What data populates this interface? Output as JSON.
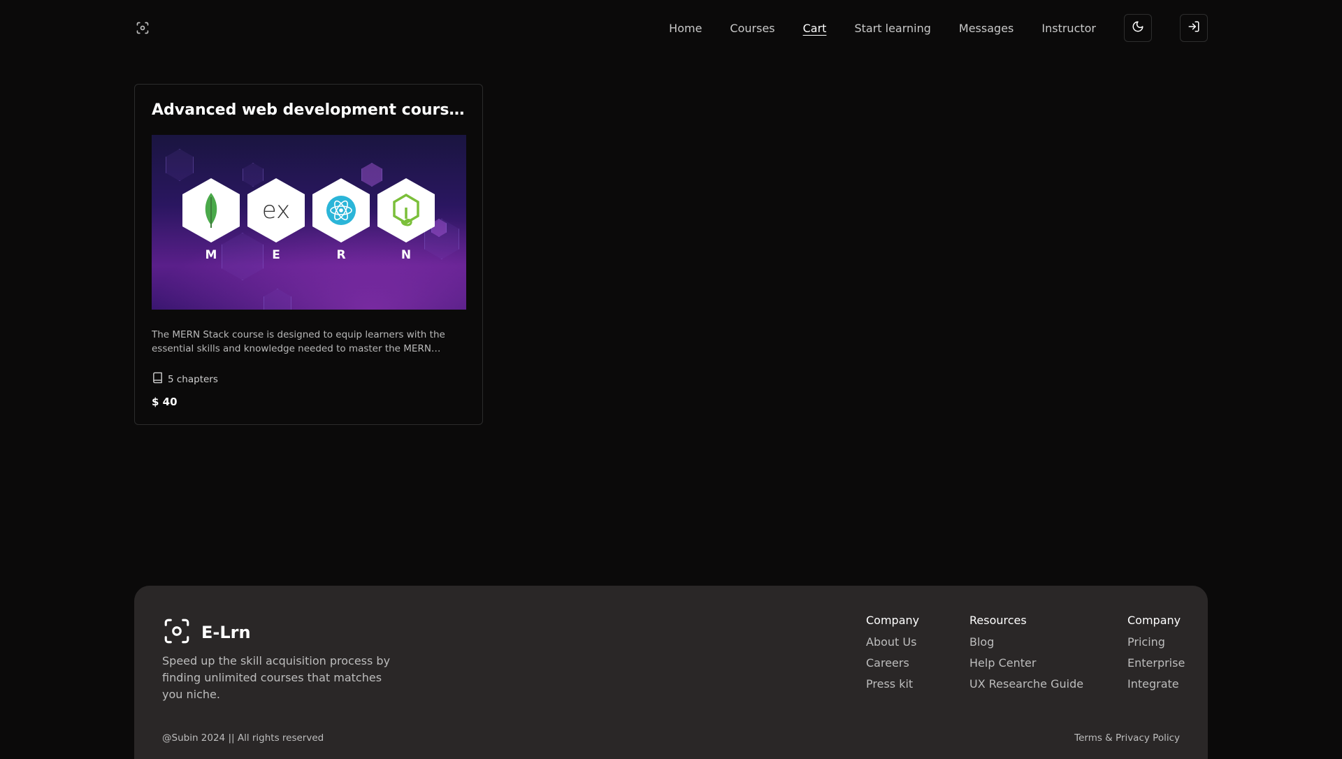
{
  "header": {
    "logo_icon": "scan-focus-icon",
    "nav": [
      {
        "label": "Home",
        "active": false
      },
      {
        "label": "Courses",
        "active": false
      },
      {
        "label": "Cart",
        "active": true
      },
      {
        "label": "Start learning",
        "active": false
      },
      {
        "label": "Messages",
        "active": false
      },
      {
        "label": "Instructor",
        "active": false
      }
    ],
    "theme_icon": "moon-icon",
    "login_icon": "log-in-icon"
  },
  "course_card": {
    "title": "Advanced web development course Me…",
    "thumbnail_letters": [
      "M",
      "E",
      "R",
      "N"
    ],
    "thumbnail_icons": [
      "mongodb-leaf-icon",
      "express-ex-icon",
      "react-atom-icon",
      "nodejs-hex-icon"
    ],
    "thumbnail_express_text": "ex",
    "description": "The MERN Stack course is designed to equip learners with the essential skills and knowledge needed to master the MERN…",
    "chapters": "5 chapters",
    "chapters_icon": "book-icon",
    "price": "$ 40"
  },
  "footer": {
    "brand_name": "E-Lrn",
    "brand_icon": "scan-focus-icon",
    "tagline": "Speed up the skill acquisition process by finding unlimited courses that matches you niche.",
    "columns": [
      {
        "heading": "Company",
        "links": [
          "About Us",
          "Careers",
          "Press kit"
        ]
      },
      {
        "heading": "Resources",
        "links": [
          "Blog",
          "Help Center",
          "UX Researche Guide"
        ]
      },
      {
        "heading": "Company",
        "links": [
          "Pricing",
          "Enterprise",
          "Integrate"
        ]
      }
    ],
    "copyright": "@Subin 2024 || All rights reserved",
    "terms": "Terms & Privacy Policy"
  },
  "colors": {
    "background": "#0b0a0a",
    "footer_bg": "#2a2727",
    "thumbnail_purple": "#5a1f8a",
    "mongo_green": "#4aa94a",
    "react_blue": "#2bb5d8",
    "node_green": "#7bbf3a"
  }
}
